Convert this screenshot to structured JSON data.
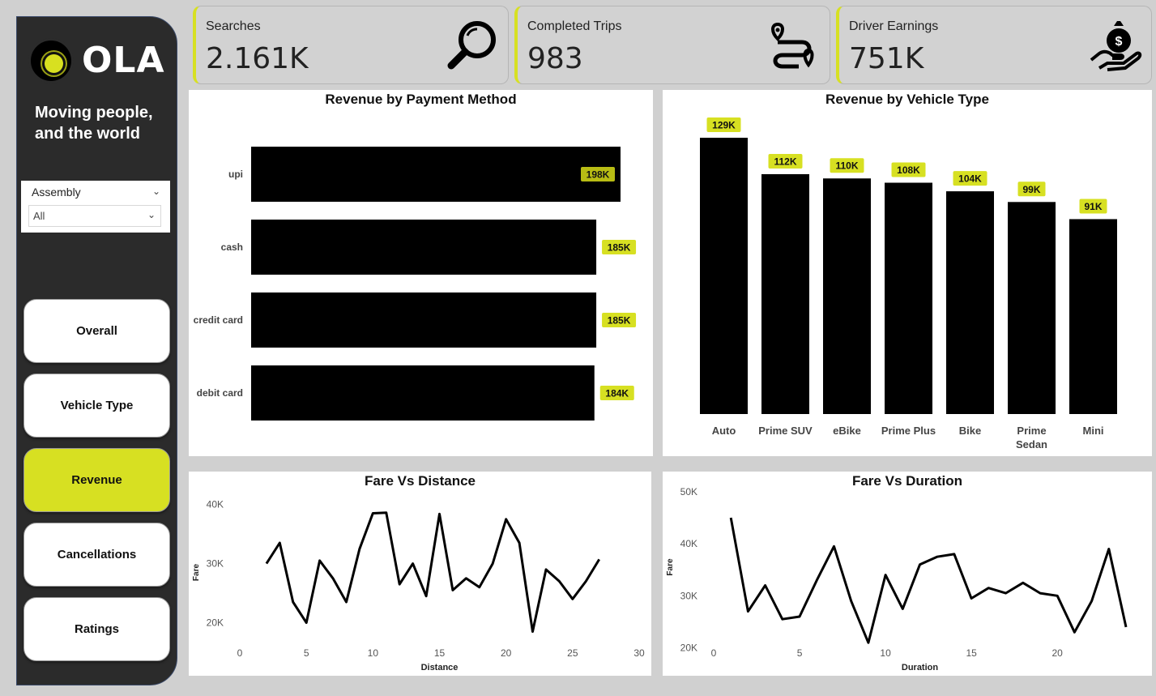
{
  "brand": {
    "logo_text": "OLA",
    "tagline": "Moving people, and the world",
    "accent_color": "#d7e022"
  },
  "slicer": {
    "title": "Assembly",
    "selected": "All"
  },
  "nav": [
    {
      "label": "Overall",
      "active": false
    },
    {
      "label": "Vehicle Type",
      "active": false
    },
    {
      "label": "Revenue",
      "active": true
    },
    {
      "label": "Cancellations",
      "active": false
    },
    {
      "label": "Ratings",
      "active": false
    }
  ],
  "kpis": [
    {
      "label": "Searches",
      "value": "2.161K",
      "icon": "search-icon"
    },
    {
      "label": "Completed Trips",
      "value": "983",
      "icon": "route-icon"
    },
    {
      "label": "Driver Earnings",
      "value": "751K",
      "icon": "money-hand-icon"
    }
  ],
  "chart_data": [
    {
      "type": "bar",
      "orientation": "horizontal",
      "title": "Revenue by Payment Method",
      "categories": [
        "upi",
        "cash",
        "credit card",
        "debit card"
      ],
      "values": [
        198,
        185,
        185,
        184
      ],
      "labels": [
        "198K",
        "185K",
        "185K",
        "184K"
      ],
      "unit": "K",
      "bar_color": "#000000",
      "label_color": "#d7e022"
    },
    {
      "type": "bar",
      "title": "Revenue by Vehicle Type",
      "categories": [
        "Auto",
        "Prime SUV",
        "eBike",
        "Prime Plus",
        "Bike",
        "Prime Sedan",
        "Mini"
      ],
      "values": [
        129,
        112,
        110,
        108,
        104,
        99,
        91
      ],
      "labels": [
        "129K",
        "112K",
        "110K",
        "108K",
        "104K",
        "99K",
        "91K"
      ],
      "unit": "K",
      "bar_color": "#000000",
      "label_color": "#d7e022"
    },
    {
      "type": "line",
      "title": "Fare Vs Distance",
      "xlabel": "Distance",
      "ylabel": "Fare",
      "xlim": [
        0,
        30
      ],
      "ylim": [
        15000,
        42000
      ],
      "xticks": [
        0,
        5,
        10,
        15,
        20,
        25,
        30
      ],
      "yticks": [
        20000,
        30000,
        40000
      ],
      "ytick_labels": [
        "20K",
        "30K",
        "40K"
      ],
      "x": [
        2,
        3,
        4,
        5,
        6,
        7,
        8,
        9,
        10,
        11,
        12,
        13,
        14,
        15,
        16,
        17,
        18,
        19,
        20,
        21,
        22,
        23,
        24,
        25,
        26,
        27
      ],
      "y": [
        30000,
        33500,
        23500,
        20000,
        30500,
        27500,
        23500,
        32500,
        38500,
        38600,
        26500,
        30000,
        24500,
        38400,
        25500,
        27500,
        26000,
        30000,
        37500,
        33500,
        18500,
        29000,
        27000,
        24000,
        27000,
        30700
      ]
    },
    {
      "type": "line",
      "title": "Fare Vs Duration",
      "xlabel": "Duration",
      "ylabel": "Fare",
      "xlim": [
        0,
        24
      ],
      "ylim": [
        19000,
        52000
      ],
      "xticks": [
        0,
        5,
        10,
        15,
        20
      ],
      "yticks": [
        20000,
        30000,
        40000,
        50000
      ],
      "ytick_labels": [
        "20K",
        "30K",
        "40K",
        "50K"
      ],
      "x": [
        1,
        2,
        3,
        4,
        5,
        6,
        7,
        8,
        9,
        10,
        11,
        12,
        13,
        14,
        15,
        16,
        17,
        18,
        19,
        20,
        21,
        22,
        23,
        24
      ],
      "y": [
        45000,
        27000,
        32000,
        25500,
        26000,
        33000,
        39500,
        29000,
        21000,
        34000,
        27500,
        36000,
        37500,
        38000,
        29500,
        31500,
        30500,
        32500,
        30500,
        30000,
        23000,
        29000,
        39000,
        24000
      ]
    }
  ]
}
